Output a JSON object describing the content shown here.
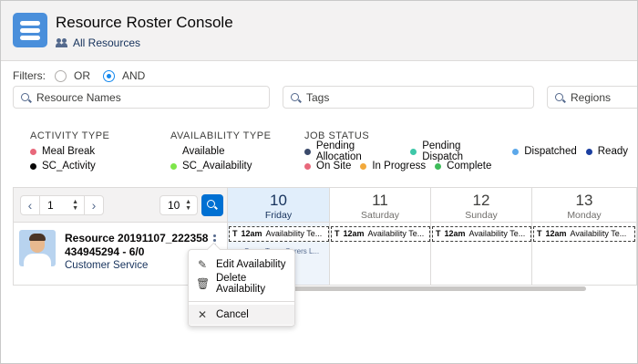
{
  "header": {
    "title": "Resource Roster Console",
    "subtitle": "All Resources",
    "app_icon": "list-icon",
    "subtitle_icon": "people-icon"
  },
  "filters": {
    "label": "Filters:",
    "options": [
      "OR",
      "AND"
    ],
    "selected": "AND"
  },
  "search_inputs": {
    "resource_names": "Resource Names",
    "tags": "Tags",
    "regions": "Regions"
  },
  "legend": {
    "activity_type": {
      "title": "ACTIVITY TYPE",
      "items": [
        {
          "label": "Meal Break",
          "color": "#e8687b"
        },
        {
          "label": "SC_Activity",
          "color": "#080707"
        }
      ]
    },
    "availability_type": {
      "title": "AVAILABILITY TYPE",
      "items": [
        {
          "label": "Available",
          "color": ""
        },
        {
          "label": "SC_Availability",
          "color": "#7ee64a"
        }
      ]
    },
    "job_status": {
      "title": "JOB STATUS",
      "row1": [
        {
          "label": "Pending Allocation",
          "color": "#3b4a6b"
        },
        {
          "label": "Pending Dispatch",
          "color": "#3ec7a8"
        },
        {
          "label": "Dispatched",
          "color": "#5ca8ea"
        },
        {
          "label": "Ready",
          "color": "#1b3fa0"
        }
      ],
      "row2": [
        {
          "label": "On Site",
          "color": "#e8687b"
        },
        {
          "label": "In Progress",
          "color": "#f2a93b"
        },
        {
          "label": "Complete",
          "color": "#3fbc5a"
        }
      ]
    }
  },
  "toolbar": {
    "page": "1",
    "page_size": "10",
    "prev_icon": "chevron-left-icon",
    "next_icon": "chevron-right-icon"
  },
  "days": [
    {
      "num": "10",
      "name": "Friday",
      "today": true
    },
    {
      "num": "11",
      "name": "Saturday",
      "today": false
    },
    {
      "num": "12",
      "name": "Sunday",
      "today": false
    },
    {
      "num": "13",
      "name": "Monday",
      "today": false
    }
  ],
  "availability_block": {
    "marker": "T",
    "time": "12am",
    "text": "Availability Te..."
  },
  "resource": {
    "name": "Resource 20191107_222358 434945294 - 6/0",
    "subtitle": "Customer Service",
    "under_text": "Some Team Carers L..."
  },
  "context_menu": {
    "items": [
      {
        "label": "Edit Availability",
        "icon": "pencil-icon"
      },
      {
        "label": "Delete Availability",
        "icon": "trash-icon"
      },
      {
        "label": "Cancel",
        "icon": "close-icon"
      }
    ]
  }
}
